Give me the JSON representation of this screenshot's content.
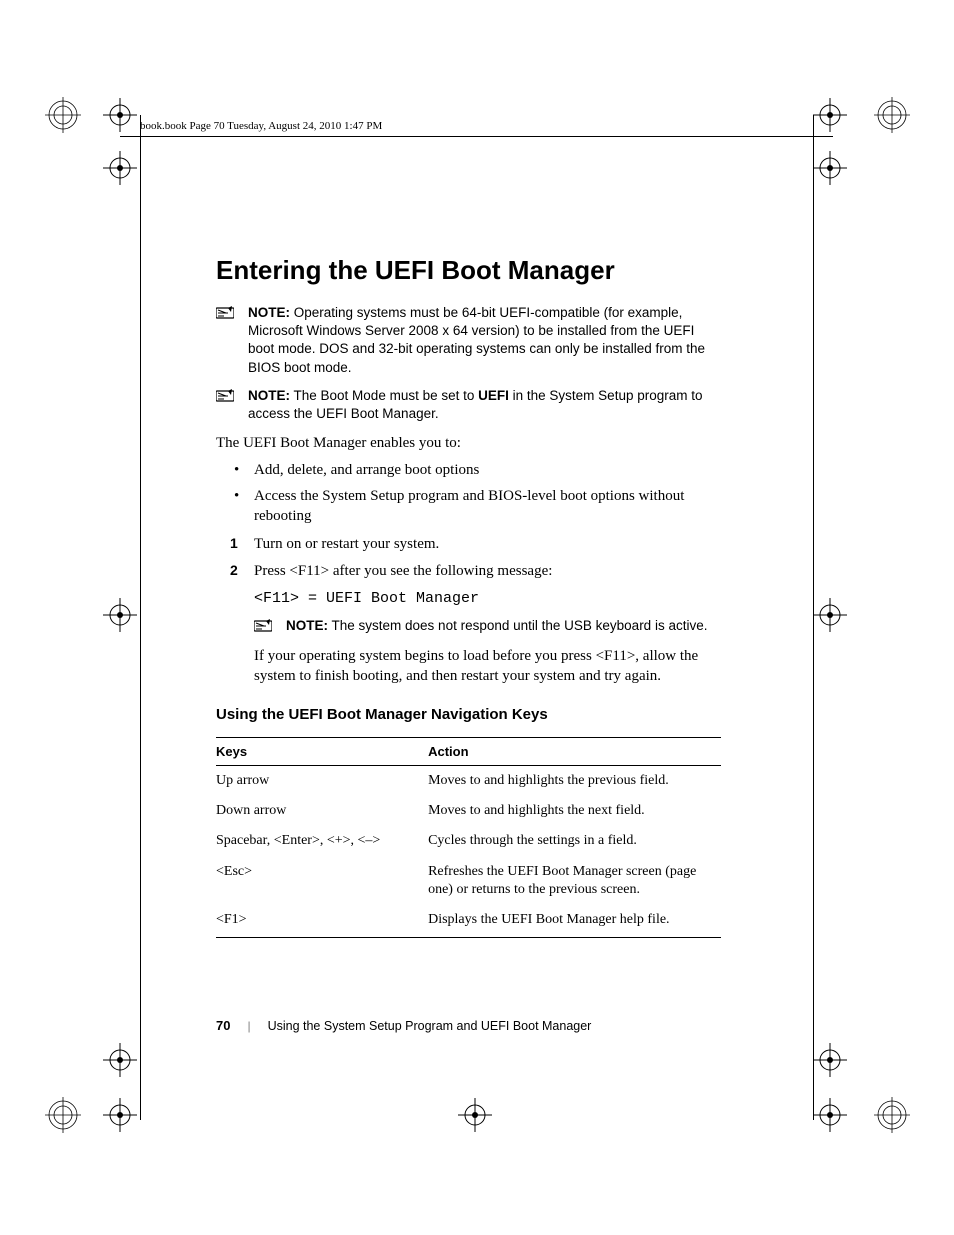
{
  "header": {
    "runningHead": "book.book  Page 70  Tuesday, August 24, 2010  1:47 PM"
  },
  "title": "Entering the UEFI Boot Manager",
  "noteLabel": "NOTE:",
  "note1": "Operating systems must be 64-bit UEFI-compatible (for example, Microsoft Windows Server 2008 x 64 version) to be installed from the UEFI boot mode. DOS and 32-bit operating systems can only be installed from the BIOS boot mode.",
  "note2_a": "The Boot Mode must be set to ",
  "note2_b": "UEFI",
  "note2_c": " in the System Setup program to access the UEFI Boot Manager.",
  "intro": "The UEFI Boot Manager enables you to:",
  "bullets": [
    "Add, delete, and arrange boot options",
    "Access the System Setup program and BIOS-level boot options without rebooting"
  ],
  "steps": [
    "Turn on or restart your system.",
    "Press <F11> after you see the following message:"
  ],
  "codeLine": "<F11> = UEFI Boot Manager",
  "note3": "The system does not respond until the USB keyboard is active.",
  "postNote": "If your operating system begins to load before you press <F11>, allow the system to finish booting, and then restart your system and try again.",
  "sectionHeading": "Using the UEFI Boot Manager Navigation Keys",
  "table": {
    "headers": {
      "keys": "Keys",
      "action": "Action"
    },
    "rows": [
      {
        "keys": "Up arrow",
        "action": "Moves to and highlights the previous field."
      },
      {
        "keys": "Down arrow",
        "action": "Moves to and highlights the next field."
      },
      {
        "keys": "Spacebar, <Enter>, <+>, <–>",
        "action": "Cycles through the settings in a field."
      },
      {
        "keys": "<Esc>",
        "action": "Refreshes the UEFI Boot Manager screen (page one) or returns to the previous screen."
      },
      {
        "keys": "<F1>",
        "action": "Displays the UEFI Boot Manager help file."
      }
    ]
  },
  "footer": {
    "pageNumber": "70",
    "separator": "|",
    "chapterTitle": "Using the System Setup Program and UEFI Boot Manager"
  }
}
